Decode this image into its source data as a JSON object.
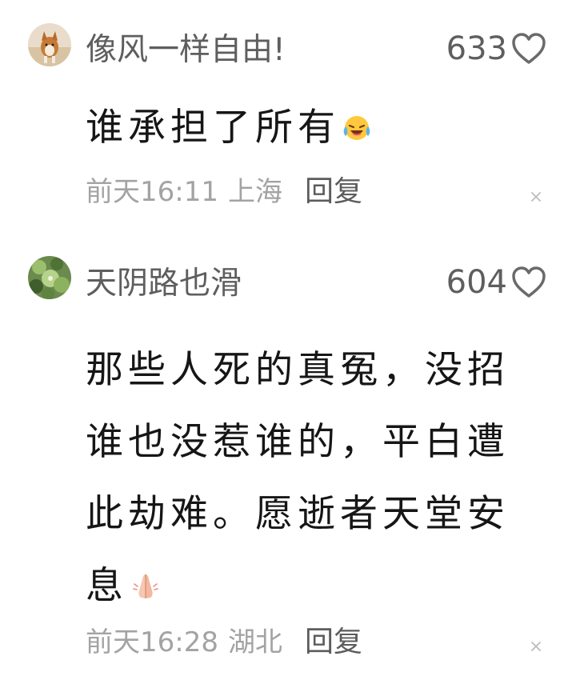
{
  "comments": [
    {
      "username": "像风一样自由!",
      "likes": "633",
      "text": "谁承担了所有",
      "time": "前天16:11",
      "location": "上海",
      "reply_label": "回复",
      "avatar": "dog-avatar",
      "emoji": "laughing-crying-emoji"
    },
    {
      "username": "天阴路也滑",
      "likes": "604",
      "text": "那些人死的真冤，没招谁也没惹谁的，平白遭此劫难。愿逝者天堂安息",
      "time": "前天16:28",
      "location": "湖北",
      "reply_label": "回复",
      "avatar": "plant-avatar",
      "emoji": "praying-hands-emoji"
    }
  ],
  "colors": {
    "username": "#5e5e5e",
    "text": "#161616",
    "meta": "#a3a3a3",
    "reply": "#5c5c5c"
  }
}
